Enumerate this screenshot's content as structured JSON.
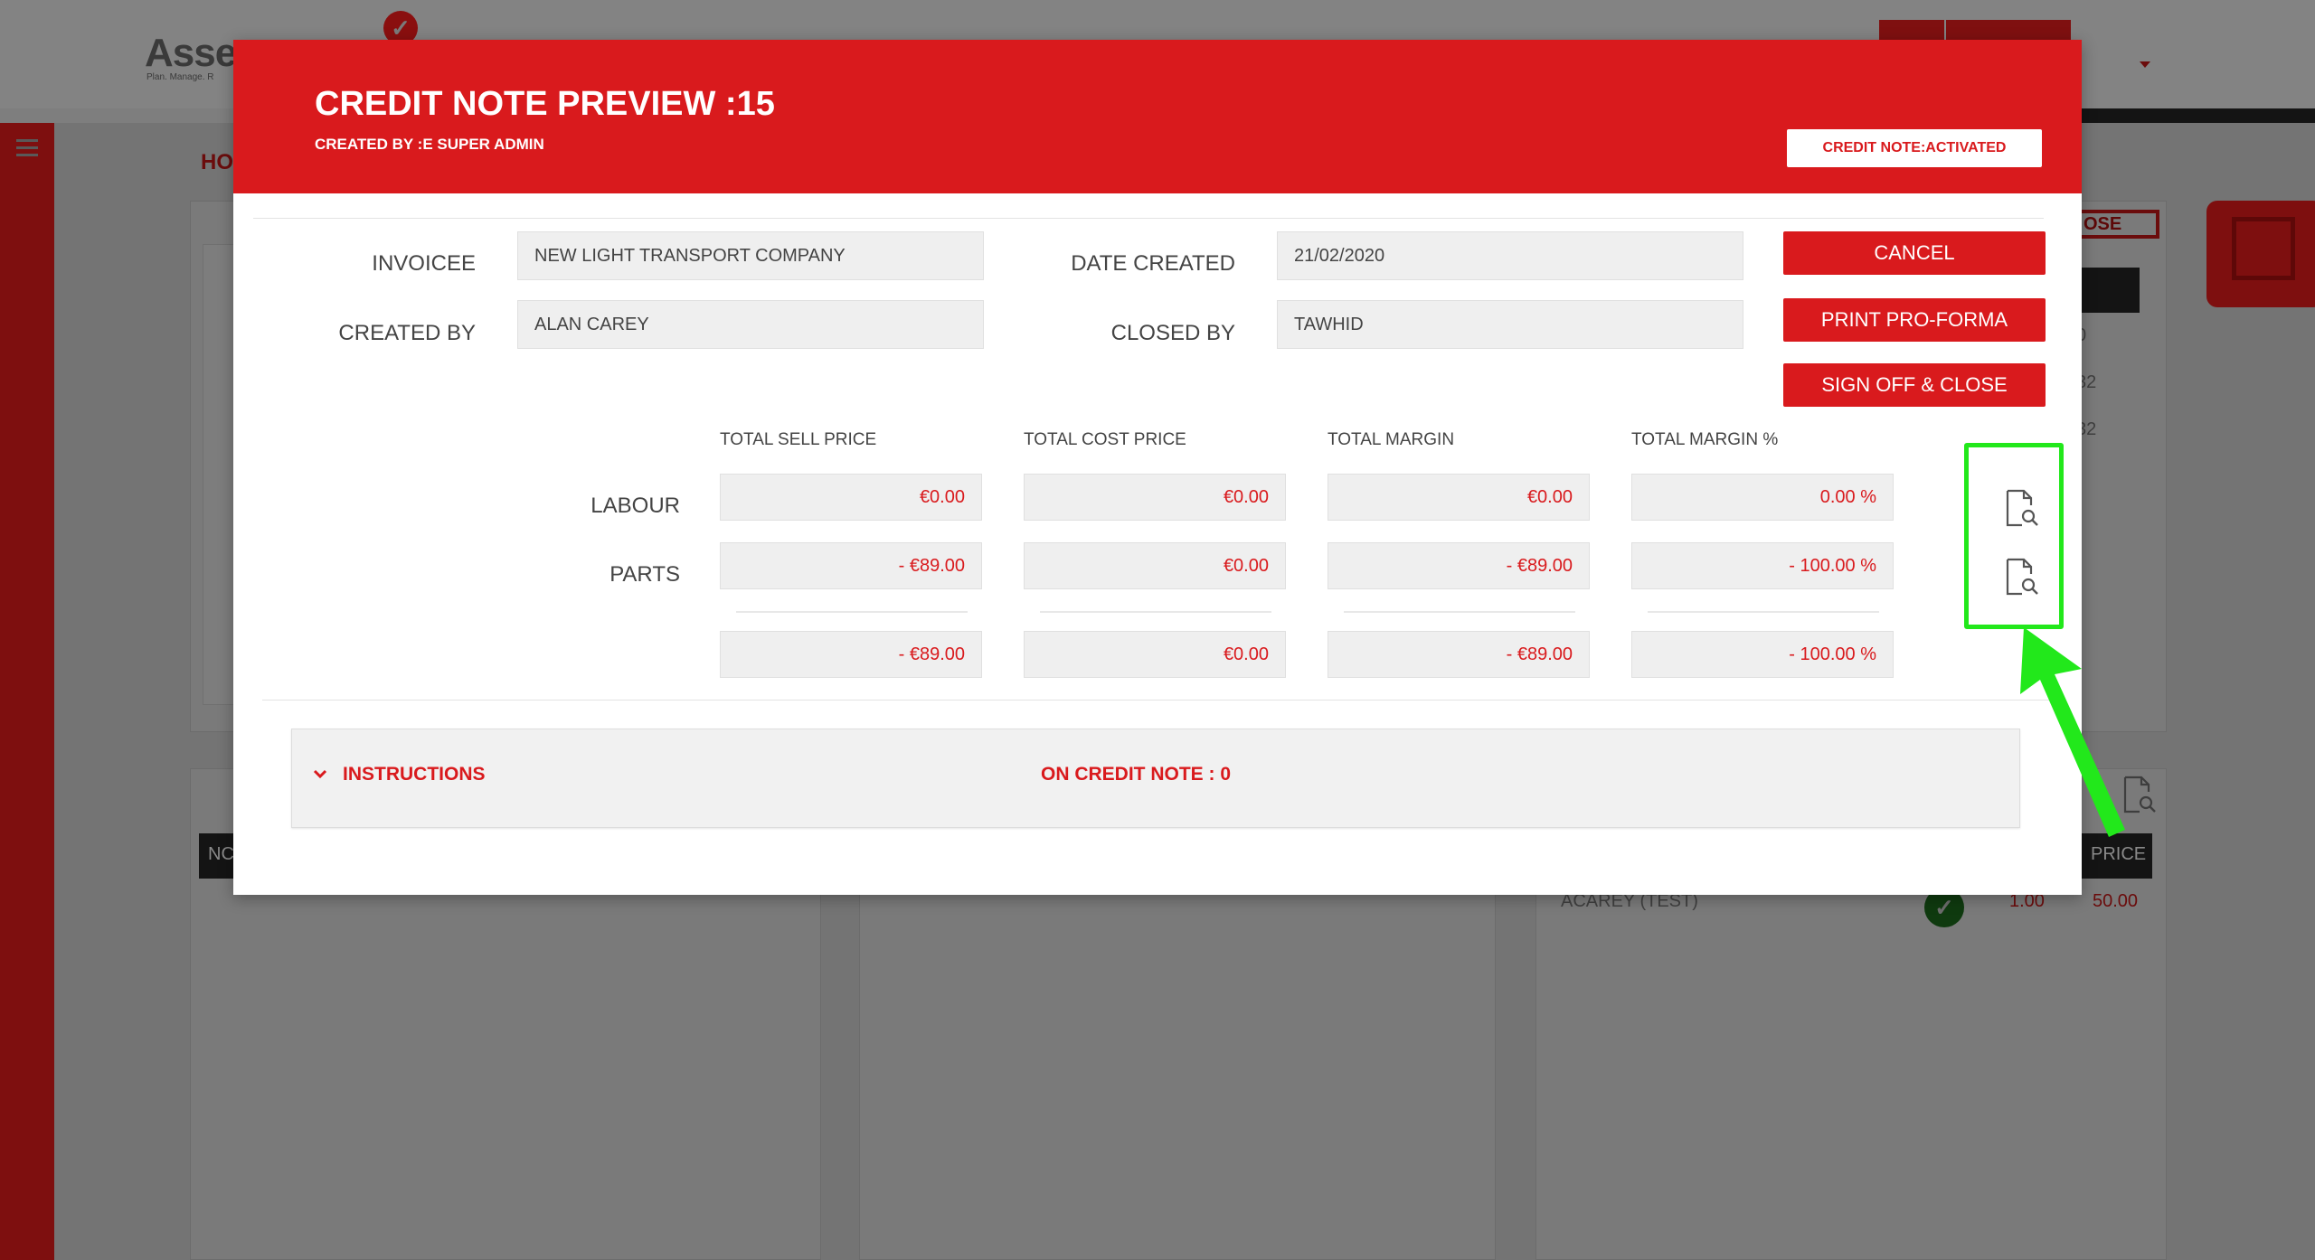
{
  "background": {
    "logo": "Asse",
    "logo_sub": "Plan. Manage. R",
    "home_crumb": "HO",
    "close_fragment": "OSE",
    "table_head_left": "NC",
    "table_head_right": "PRICE",
    "row_user": "ACAREY (TEST)",
    "row_qty": "1.00",
    "row_price": "50.00",
    "side_vals": [
      "0",
      "32",
      "32"
    ]
  },
  "modal": {
    "title": "CREDIT NOTE PREVIEW :15",
    "subtitle": "CREATED BY :E SUPER ADMIN",
    "status": "CREDIT NOTE:ACTIVATED",
    "fields": {
      "invoicee_label": "INVOICEE",
      "invoicee_value": "NEW LIGHT TRANSPORT COMPANY",
      "created_by_label": "CREATED BY",
      "created_by_value": "ALAN CAREY",
      "date_created_label": "DATE CREATED",
      "date_created_value": "21/02/2020",
      "closed_by_label": "CLOSED BY",
      "closed_by_value": "TAWHID"
    },
    "buttons": {
      "cancel": "CANCEL",
      "print": "PRINT PRO-FORMA",
      "sign_off": "SIGN OFF & CLOSE"
    },
    "totals": {
      "headers": [
        "TOTAL SELL PRICE",
        "TOTAL COST PRICE",
        "TOTAL MARGIN",
        "TOTAL MARGIN %"
      ],
      "rows": [
        {
          "label": "LABOUR",
          "values": [
            "€0.00",
            "€0.00",
            "€0.00",
            "0.00 %"
          ]
        },
        {
          "label": "PARTS",
          "values": [
            "- €89.00",
            "€0.00",
            "- €89.00",
            "- 100.00 %"
          ]
        },
        {
          "label": "",
          "values": [
            "- €89.00",
            "€0.00",
            "- €89.00",
            "- 100.00 %"
          ]
        }
      ]
    },
    "instructions": {
      "label": "INSTRUCTIONS",
      "count": "ON CREDIT NOTE : 0"
    }
  },
  "colors": {
    "brand_red": "#d91a1d",
    "annotation_green": "#22e81b"
  },
  "icons": [
    "check-icon",
    "hamburger-icon",
    "document-search-icon",
    "chevron-down-icon",
    "edit-icon"
  ]
}
